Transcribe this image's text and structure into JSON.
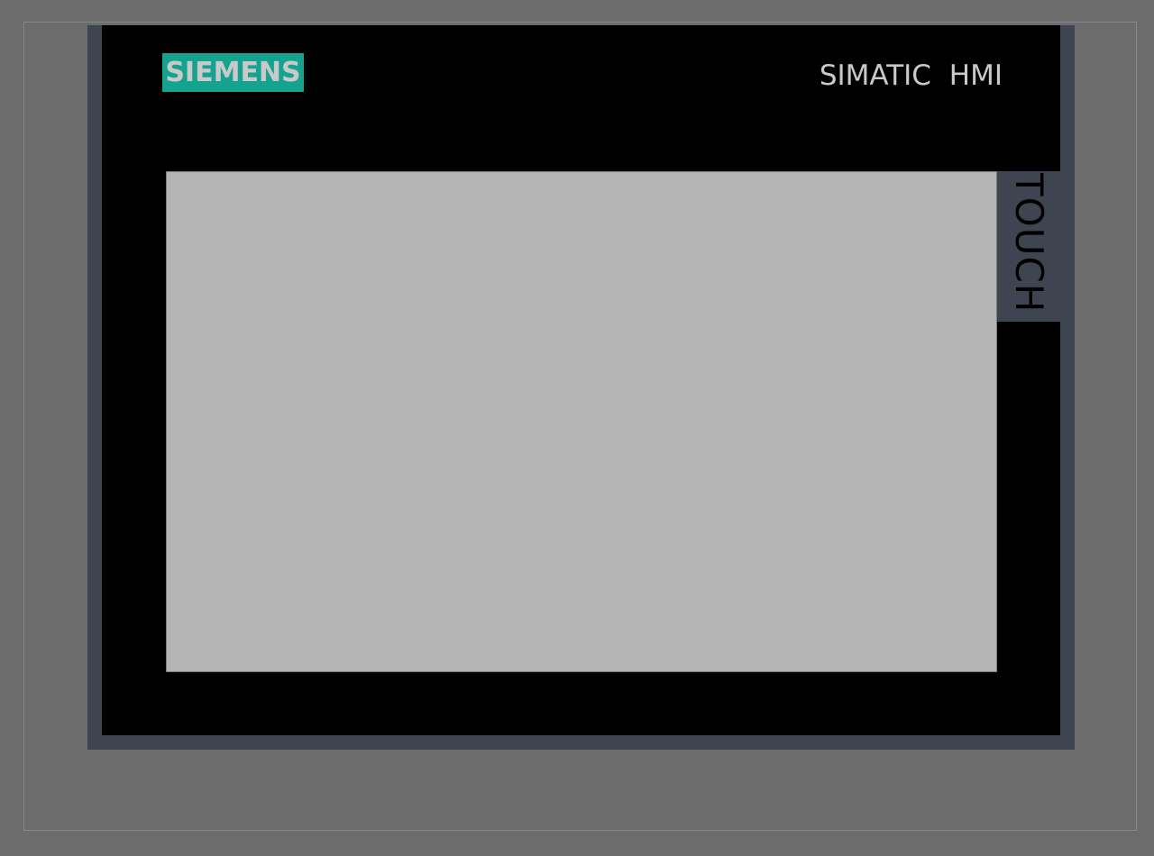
{
  "device": {
    "brand": "SIEMENS",
    "product": "SIMATIC HMI",
    "touch_label": "TOUCH"
  },
  "colors": {
    "background": "#6c6c6c",
    "housing": "#3f4550",
    "face": "#000000",
    "brand_accent": "#13a38f",
    "label_text": "#c9c9c9",
    "screen": "#b4b4b4"
  }
}
